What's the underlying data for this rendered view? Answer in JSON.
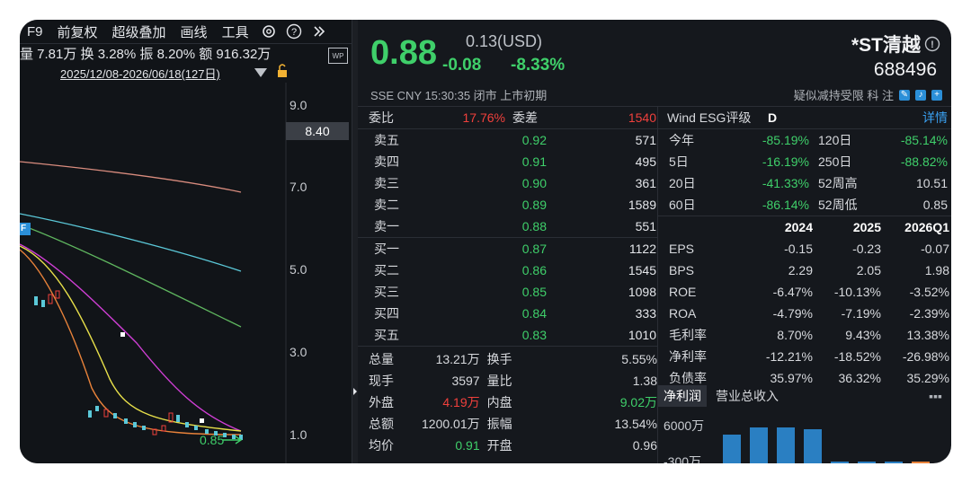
{
  "toolbar": {
    "items": [
      "F9",
      "前复权",
      "超级叠加",
      "画线",
      "工具"
    ],
    "icons": [
      "gear-icon",
      "help-icon",
      "expand-icon"
    ]
  },
  "chart_stats": "量 7.81万  换 3.28%  振 8.20%  额 916.32万",
  "date_range": "2025/12/08-2026/06/18(127日)",
  "wp_label": "WP",
  "axis": {
    "labels": [
      "9.0",
      "7.0",
      "5.0",
      "3.0",
      "1.0"
    ],
    "price_tag": "8.40",
    "last_label": "0.85",
    "f_label": "F"
  },
  "quote": {
    "price": "0.88",
    "usd": "0.13(USD)",
    "change": "-0.08",
    "change_pct": "-8.33%",
    "name": "*ST清越",
    "code": "688496",
    "meta": "SSE  CNY  15:30:35  闭市  上市初期",
    "meta_right": "疑似减持受限   科  注"
  },
  "orderbook": {
    "header": {
      "label": "委比",
      "value": "17.76%",
      "label2": "委差",
      "value2": "1540"
    },
    "sell": [
      {
        "label": "卖五",
        "price": "0.92",
        "vol": "571"
      },
      {
        "label": "卖四",
        "price": "0.91",
        "vol": "495"
      },
      {
        "label": "卖三",
        "price": "0.90",
        "vol": "361"
      },
      {
        "label": "卖二",
        "price": "0.89",
        "vol": "1589"
      },
      {
        "label": "卖一",
        "price": "0.88",
        "vol": "551"
      }
    ],
    "buy": [
      {
        "label": "买一",
        "price": "0.87",
        "vol": "1122"
      },
      {
        "label": "买二",
        "price": "0.86",
        "vol": "1545"
      },
      {
        "label": "买三",
        "price": "0.85",
        "vol": "1098"
      },
      {
        "label": "买四",
        "price": "0.84",
        "vol": "333"
      },
      {
        "label": "买五",
        "price": "0.83",
        "vol": "1010"
      }
    ]
  },
  "bottom_stats": [
    {
      "l": "总量",
      "v": "13.21万",
      "l2": "换手",
      "v2": "5.55%"
    },
    {
      "l": "现手",
      "v": "3597",
      "l2": "量比",
      "v2": "1.38"
    },
    {
      "l": "外盘",
      "v": "4.19万",
      "l2": "内盘",
      "v2": "9.02万"
    },
    {
      "l": "总额",
      "v": "1200.01万",
      "l2": "振幅",
      "v2": "13.54%"
    },
    {
      "l": "均价",
      "v": "0.91",
      "l2": "开盘",
      "v2": "0.96"
    }
  ],
  "esg": {
    "label": "Wind ESG评级",
    "grade": "D",
    "detail": "详情",
    "rows": [
      {
        "a": "今年",
        "b": "-85.19%",
        "c": "120日",
        "d": "-85.14%"
      },
      {
        "a": "5日",
        "b": "-16.19%",
        "c": "250日",
        "d": "-88.82%"
      },
      {
        "a": "20日",
        "b": "-41.33%",
        "c": "52周高",
        "d": "10.51"
      },
      {
        "a": "60日",
        "b": "-86.14%",
        "c": "52周低",
        "d": "0.85"
      }
    ]
  },
  "financials": {
    "years": [
      "2024",
      "2025",
      "2026Q1"
    ],
    "rows": [
      {
        "name": "EPS",
        "vals": [
          "-0.15",
          "-0.23",
          "-0.07"
        ]
      },
      {
        "name": "BPS",
        "vals": [
          "2.29",
          "2.05",
          "1.98"
        ]
      },
      {
        "name": "ROE",
        "vals": [
          "-6.47%",
          "-10.13%",
          "-3.52%"
        ]
      },
      {
        "name": "ROA",
        "vals": [
          "-4.79%",
          "-7.19%",
          "-2.39%"
        ]
      },
      {
        "name": "毛利率",
        "vals": [
          "8.70%",
          "9.43%",
          "13.38%"
        ]
      },
      {
        "name": "净利率",
        "vals": [
          "-12.21%",
          "-18.52%",
          "-26.98%"
        ]
      },
      {
        "name": "负债率",
        "vals": [
          "35.97%",
          "36.32%",
          "35.29%"
        ]
      }
    ]
  },
  "tabs2": [
    "净利润",
    "营业总收入"
  ],
  "mini_chart": {
    "label_top": "6000万",
    "label_bottom": "-300万"
  },
  "colors": {
    "up": "#f0403c",
    "down": "#3fcf6a",
    "accent": "#2b8fd8"
  }
}
